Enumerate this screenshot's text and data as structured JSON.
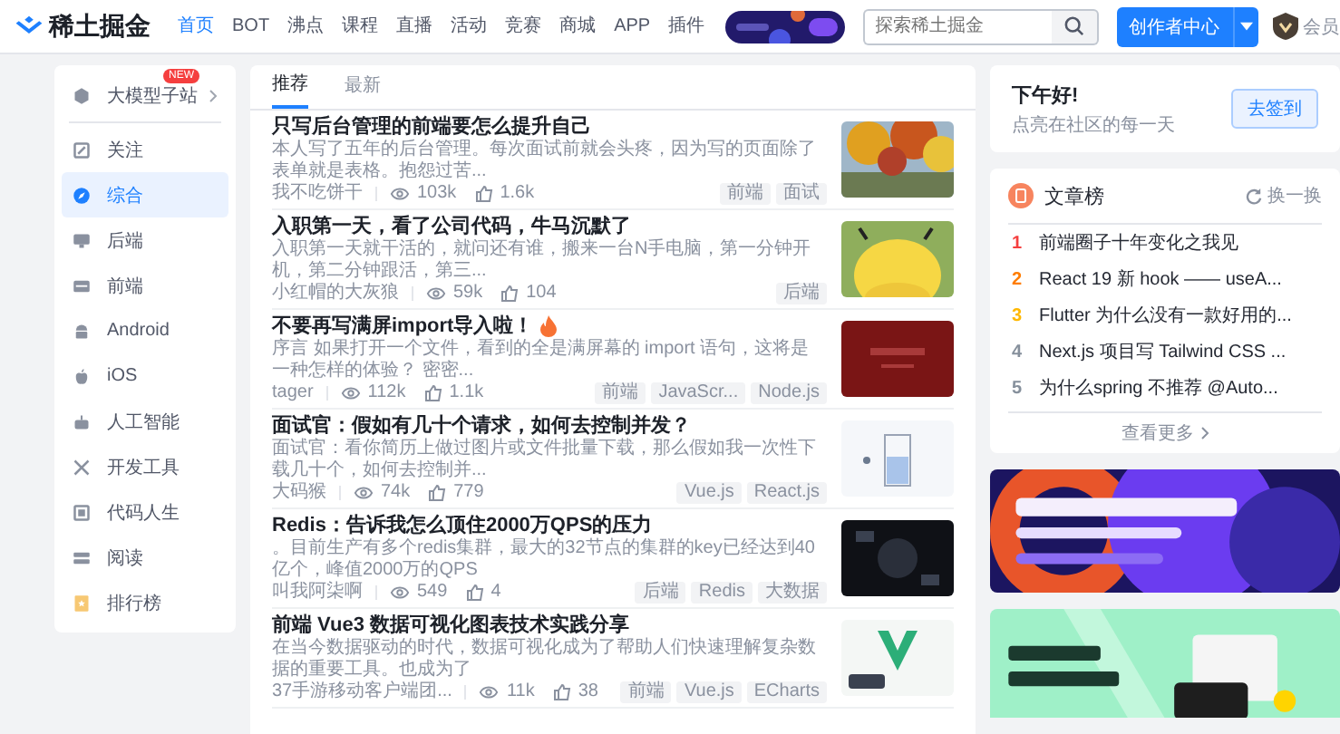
{
  "header": {
    "logo": "稀土掘金",
    "nav": [
      {
        "label": "首页",
        "selected": true
      },
      {
        "label": "BOT",
        "selected": false
      },
      {
        "label": "沸点",
        "selected": false
      },
      {
        "label": "课程",
        "selected": false
      },
      {
        "label": "直播",
        "selected": false
      },
      {
        "label": "活动",
        "selected": false
      },
      {
        "label": "竞赛",
        "selected": false
      },
      {
        "label": "商城",
        "selected": false
      },
      {
        "label": "APP",
        "selected": false
      },
      {
        "label": "插件",
        "selected": false
      }
    ],
    "search": {
      "placeholder": "探索稀土掘金"
    },
    "creator_button": "创作者中心",
    "member": "会员"
  },
  "sidebar": {
    "items": [
      {
        "label": "大模型子站",
        "kind": "link",
        "badge": "NEW",
        "selected": false
      },
      {
        "label": "关注",
        "kind": "category",
        "selected": false
      },
      {
        "label": "综合",
        "kind": "category",
        "selected": true
      },
      {
        "label": "后端",
        "kind": "category",
        "selected": false
      },
      {
        "label": "前端",
        "kind": "category",
        "selected": false
      },
      {
        "label": "Android",
        "kind": "category",
        "selected": false
      },
      {
        "label": "iOS",
        "kind": "category",
        "selected": false
      },
      {
        "label": "人工智能",
        "kind": "category",
        "selected": false
      },
      {
        "label": "开发工具",
        "kind": "category",
        "selected": false
      },
      {
        "label": "代码人生",
        "kind": "category",
        "selected": false
      },
      {
        "label": "阅读",
        "kind": "category",
        "selected": false
      },
      {
        "label": "排行榜",
        "kind": "category",
        "selected": false
      }
    ]
  },
  "feed": {
    "tabs": [
      {
        "label": "推荐",
        "selected": true
      },
      {
        "label": "最新",
        "selected": false
      }
    ],
    "articles": [
      {
        "title": "只写后台管理的前端要怎么提升自己",
        "hot": false,
        "abstract": "本人写了五年的后台管理。每次面试前就会头疼，因为写的页面除了表单就是表格。抱怨过苦...",
        "author": "我不吃饼干",
        "views": "103k",
        "likes": "1.6k",
        "tags": [
          "前端",
          "面试"
        ]
      },
      {
        "title": "入职第一天，看了公司代码，牛马沉默了",
        "hot": false,
        "abstract": "入职第一天就干活的，就问还有谁，搬来一台N手电脑，第一分钟开机，第二分钟跟活，第三...",
        "author": "小红帽的大灰狼",
        "views": "59k",
        "likes": "104",
        "tags": [
          "后端"
        ]
      },
      {
        "title": "不要再写满屏import导入啦！",
        "hot": true,
        "abstract": "序言 如果打开一个文件，看到的全是满屏幕的 import 语句，这将是一种怎样的体验？ 密密...",
        "author": "tager",
        "views": "112k",
        "likes": "1.1k",
        "tags": [
          "前端",
          "JavaScr...",
          "Node.js"
        ]
      },
      {
        "title": "面试官：假如有几十个请求，如何去控制并发？",
        "hot": false,
        "abstract": "面试官：看你简历上做过图片或文件批量下载，那么假如我一次性下载几十个，如何去控制并...",
        "author": "大码猴",
        "views": "74k",
        "likes": "779",
        "tags": [
          "Vue.js",
          "React.js"
        ]
      },
      {
        "title": "Redis：告诉我怎么顶住2000万QPS的压力",
        "hot": false,
        "abstract": "。目前生产有多个redis集群，最大的32节点的集群的key已经达到40亿个，峰值2000万的QPS",
        "author": "叫我阿柒啊",
        "views": "549",
        "likes": "4",
        "tags": [
          "后端",
          "Redis",
          "大数据"
        ]
      },
      {
        "title": "前端 Vue3 数据可视化图表技术实践分享",
        "hot": false,
        "abstract": "在当今数据驱动的时代，数据可视化成为了帮助人们快速理解复杂数据的重要工具。也成为了",
        "author": "37手游移动客户端团...",
        "views": "11k",
        "likes": "38",
        "tags": [
          "前端",
          "Vue.js",
          "ECharts"
        ]
      }
    ]
  },
  "greeting": {
    "title": "下午好!",
    "subtitle": "点亮在社区的每一天",
    "button": "去签到"
  },
  "ranking": {
    "title": "文章榜",
    "refresh": "换一换",
    "items": [
      {
        "rank": "1",
        "color": "#f53f3f",
        "title": "前端圈子十年变化之我见"
      },
      {
        "rank": "2",
        "color": "#ff7d00",
        "title": "React 19 新 hook —— useA..."
      },
      {
        "rank": "3",
        "color": "#ffb800",
        "title": "Flutter 为什么没有一款好用的..."
      },
      {
        "rank": "4",
        "color": "#86909c",
        "title": "Next.js 项目写 Tailwind CSS ..."
      },
      {
        "rank": "5",
        "color": "#86909c",
        "title": "为什么spring 不推荐 @Auto..."
      }
    ],
    "more": "查看更多"
  }
}
